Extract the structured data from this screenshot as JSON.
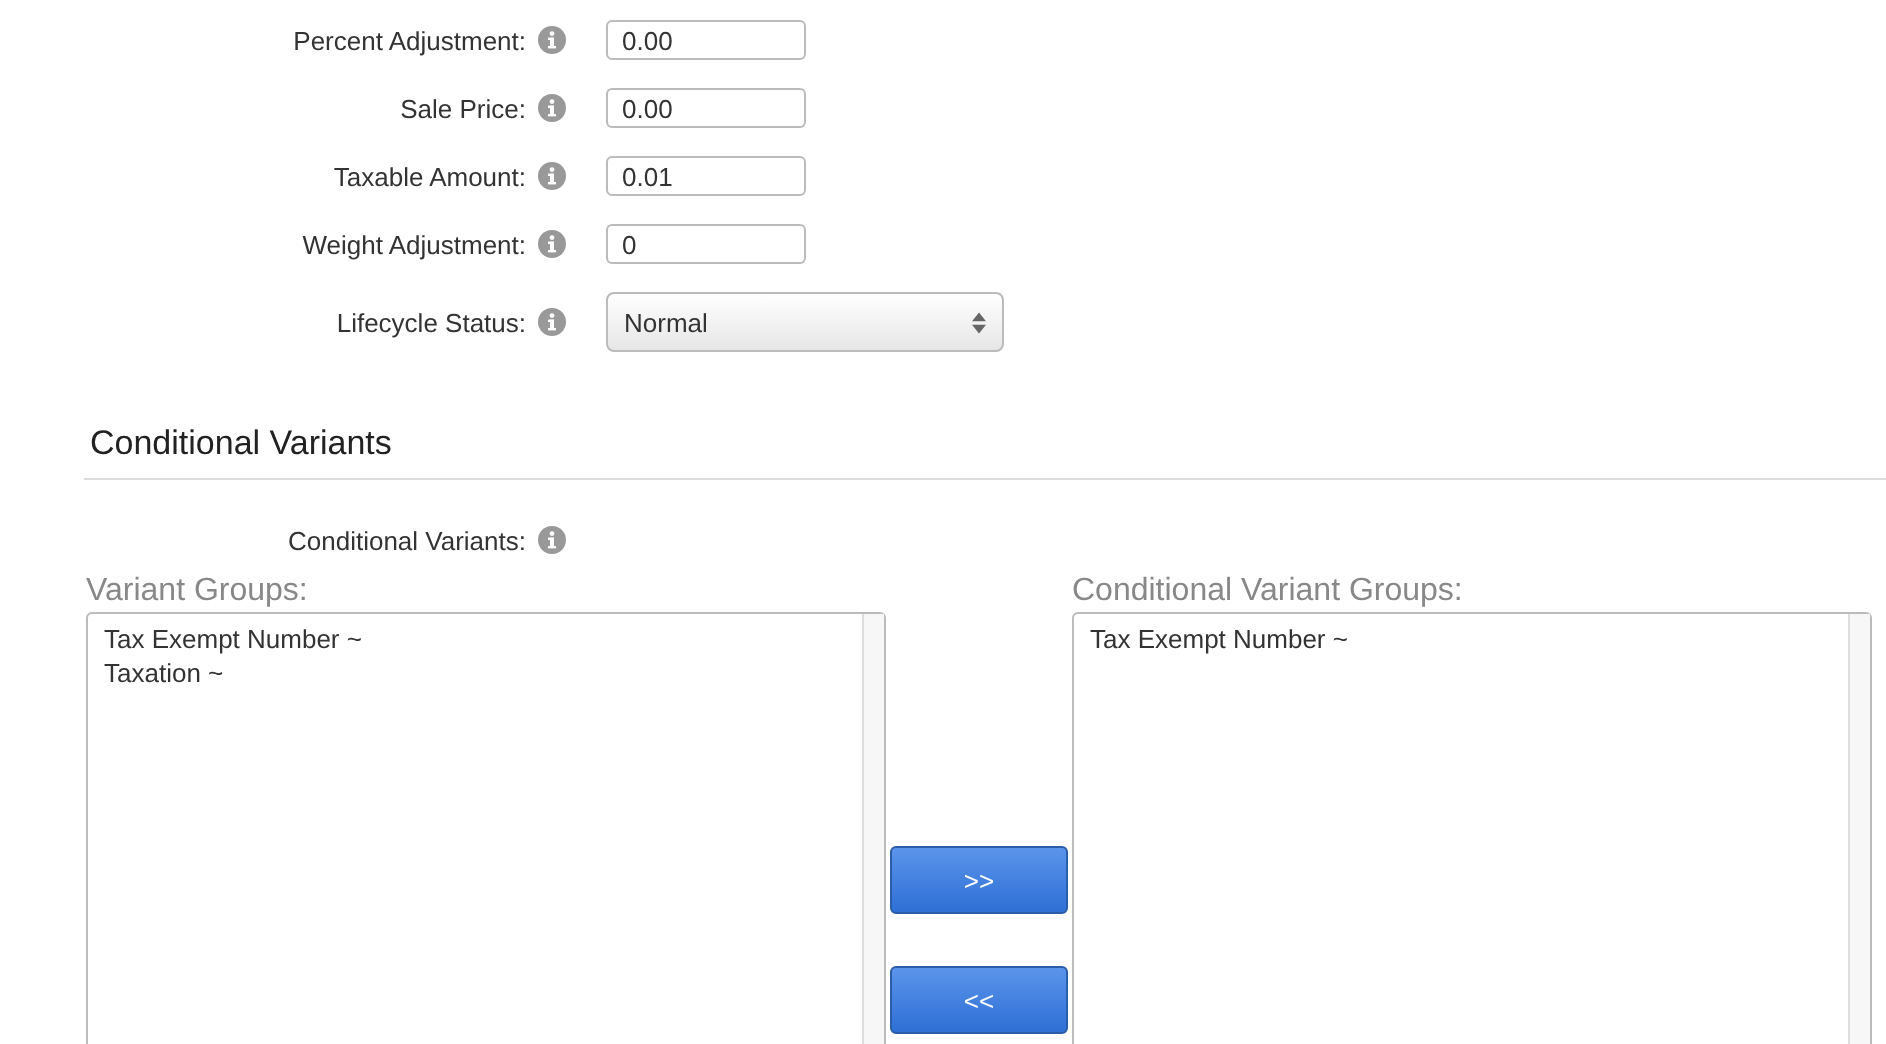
{
  "fields": [
    {
      "label": "Percent Adjustment:",
      "kind": "text",
      "value": "0.00"
    },
    {
      "label": "Sale Price:",
      "kind": "text",
      "value": "0.00"
    },
    {
      "label": "Taxable Amount:",
      "kind": "text",
      "value": "0.01"
    },
    {
      "label": "Weight Adjustment:",
      "kind": "text",
      "value": "0"
    },
    {
      "label": "Lifecycle Status:",
      "kind": "select",
      "value": "Normal"
    }
  ],
  "section": {
    "title": "Conditional Variants",
    "field_label": "Conditional Variants:",
    "available": {
      "label": "Variant Groups:",
      "items": [
        "Tax Exempt Number ~",
        "Taxation ~"
      ]
    },
    "chosen": {
      "label": "Conditional Variant Groups:",
      "items": [
        "Tax Exempt Number ~"
      ]
    },
    "buttons": [
      ">>",
      "<<"
    ]
  }
}
